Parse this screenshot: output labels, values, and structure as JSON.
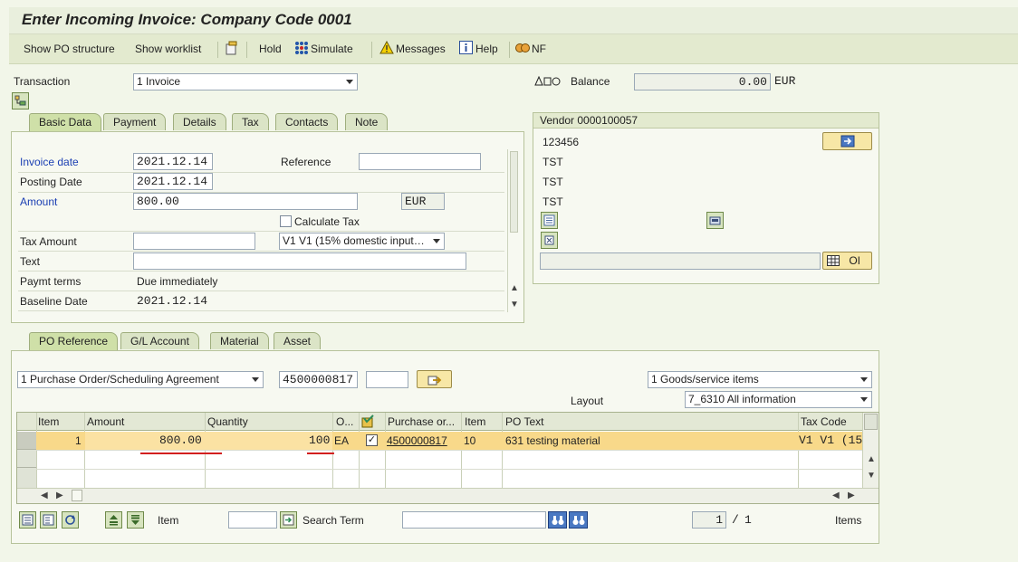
{
  "title": "Enter Incoming Invoice: Company Code 0001",
  "toolbar": {
    "show_po_structure": "Show PO structure",
    "show_worklist": "Show worklist",
    "hold": "Hold",
    "simulate": "Simulate",
    "messages": "Messages",
    "help": "Help",
    "nf": "NF"
  },
  "transaction": {
    "label": "Transaction",
    "value": "1 Invoice"
  },
  "balance": {
    "label": "Balance",
    "value": "0.00",
    "currency": "EUR"
  },
  "header_tabs": [
    "Basic Data",
    "Payment",
    "Details",
    "Tax",
    "Contacts",
    "Note"
  ],
  "basic": {
    "invoice_date_label": "Invoice date",
    "invoice_date": "2021.12.14",
    "reference_label": "Reference",
    "reference": "",
    "posting_date_label": "Posting Date",
    "posting_date": "2021.12.14",
    "amount_label": "Amount",
    "amount": "800.00",
    "currency": "EUR",
    "calculate_tax_label": "Calculate Tax",
    "tax_amount_label": "Tax Amount",
    "tax_amount": "",
    "tax_code": "V1 V1 (15% domestic input…",
    "text_label": "Text",
    "text": "",
    "paymt_terms_label": "Paymt terms",
    "paymt_terms": "Due immediately",
    "baseline_date_label": "Baseline Date",
    "baseline_date": "2021.12.14"
  },
  "vendor": {
    "header": "Vendor 0000100057",
    "lines": [
      "123456",
      "TST",
      "TST",
      "TST"
    ],
    "oi_label": "OI"
  },
  "item_tabs": [
    "PO Reference",
    "G/L Account",
    "Material",
    "Asset"
  ],
  "po_ref": {
    "doc_type": "1 Purchase Order/Scheduling Agreement",
    "po_number": "4500000817",
    "po_item": "",
    "items_type": "1 Goods/service items",
    "layout_label": "Layout",
    "layout": "7_6310 All information"
  },
  "grid": {
    "headers": [
      "Item",
      "Amount",
      "Quantity",
      "O...",
      "Purchase or...",
      "Item",
      "PO Text",
      "Tax Code"
    ],
    "rows": [
      {
        "item": "1",
        "amount": "800.00",
        "quantity": "100",
        "unit": "EA",
        "checked": true,
        "po": "4500000817",
        "po_item": "10",
        "po_text": "631 testing material",
        "tax_code": "V1 V1 (15"
      }
    ]
  },
  "footer": {
    "item_label": "Item",
    "item_value": "",
    "search_term_label": "Search Term",
    "search_term": "",
    "page_current": "1",
    "page_sep": "/",
    "page_total": "1",
    "items_label": "Items"
  },
  "colors": {
    "row_highlight": "#f8d98a",
    "annotation": "#d21f1f",
    "header_bg": "#e9efdd"
  }
}
